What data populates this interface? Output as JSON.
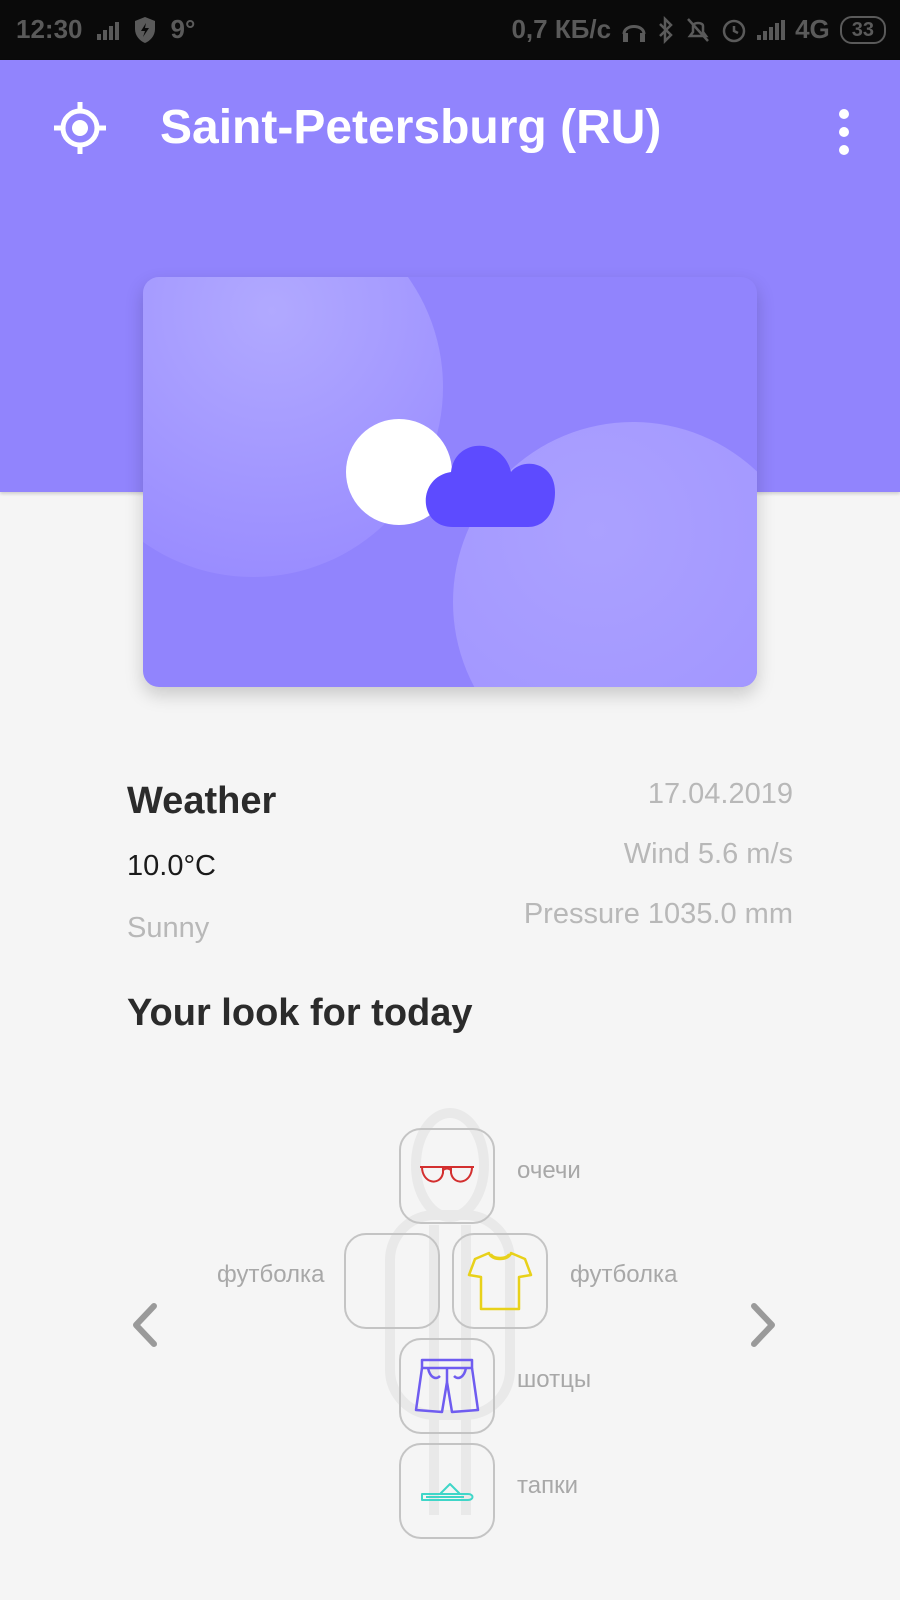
{
  "status_bar": {
    "time": "12:30",
    "temp_indicator": "9°",
    "network_speed": "0,7 КБ/с",
    "network_type": "4G",
    "battery": "33"
  },
  "app_bar": {
    "title": "Saint-Petersburg (RU)",
    "accent_color": "#9184fd"
  },
  "weather_card": {
    "icon": "sun-behind-cloud"
  },
  "weather": {
    "heading": "Weather",
    "temperature": "10.0°C",
    "condition": "Sunny",
    "date": "17.04.2019",
    "wind": "Wind 5.6 m/s",
    "pressure": "Pressure 1035.0 mm"
  },
  "look": {
    "heading": "Your look for today",
    "items": [
      {
        "slot": "head",
        "label": "очечи",
        "icon": "sunglasses-icon",
        "color": "#d32f2f"
      },
      {
        "slot": "outerwear",
        "label": "футболка",
        "icon": "",
        "color": ""
      },
      {
        "slot": "top",
        "label": "футболка",
        "icon": "tshirt-icon",
        "color": "#e8d11a"
      },
      {
        "slot": "bottom",
        "label": "шотцы",
        "icon": "shorts-icon",
        "color": "#6f5cf0"
      },
      {
        "slot": "feet",
        "label": "тапки",
        "icon": "flip-flops-icon",
        "color": "#3fd6c8"
      }
    ]
  }
}
